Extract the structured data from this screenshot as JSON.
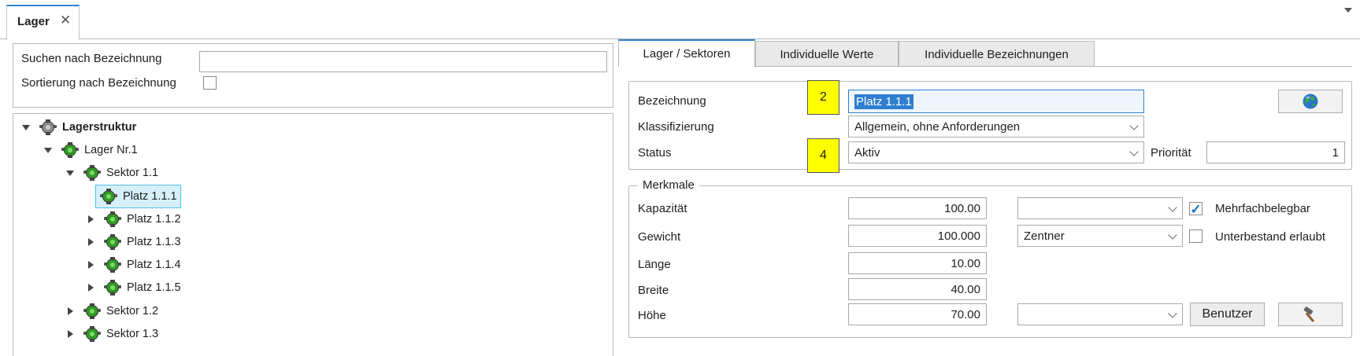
{
  "doc_tab": {
    "label": "Lager",
    "close": "✕"
  },
  "search": {
    "label": "Suchen nach Bezeichnung",
    "value": "",
    "sort_label": "Sortierung nach Bezeichnung",
    "sort_checked": false
  },
  "tree": {
    "nodes": [
      {
        "label": "Lagerstruktur",
        "level": 0,
        "expander": "expanded",
        "bold": true
      },
      {
        "label": "Lager Nr.1",
        "level": 1,
        "expander": "expanded"
      },
      {
        "label": "Sektor 1.1",
        "level": 2,
        "expander": "expanded"
      },
      {
        "label": "Platz 1.1.1",
        "level": 3,
        "expander": "none",
        "selected": true
      },
      {
        "label": "Platz 1.1.2",
        "level": 3,
        "expander": "collapsed"
      },
      {
        "label": "Platz 1.1.3",
        "level": 3,
        "expander": "collapsed"
      },
      {
        "label": "Platz 1.1.4",
        "level": 3,
        "expander": "collapsed"
      },
      {
        "label": "Platz 1.1.5",
        "level": 3,
        "expander": "collapsed"
      },
      {
        "label": "Sektor 1.2",
        "level": 2,
        "expander": "collapsed"
      },
      {
        "label": "Sektor 1.3",
        "level": 2,
        "expander": "collapsed"
      }
    ]
  },
  "tabs": [
    {
      "label": "Lager / Sektoren",
      "active": true
    },
    {
      "label": "Individuelle Werte",
      "active": false
    },
    {
      "label": "Individuelle Bezeichnungen",
      "active": false
    }
  ],
  "general": {
    "bezeichnung_label": "Bezeichnung",
    "bezeichnung_value": "Platz 1.1.1",
    "klassifizierung_label": "Klassifizierung",
    "klassifizierung_value": "Allgemein, ohne Anforderungen",
    "status_label": "Status",
    "status_value": "Aktiv",
    "prioritaet_label": "Priorität",
    "prioritaet_value": "1",
    "note_2": "2",
    "note_4": "4"
  },
  "merkmale": {
    "legend": "Merkmale",
    "rows": [
      {
        "label": "Kapazität",
        "value": "100.00",
        "unit": ""
      },
      {
        "label": "Gewicht",
        "value": "100.000",
        "unit": "Zentner"
      },
      {
        "label": "Länge",
        "value": "10.00"
      },
      {
        "label": "Breite",
        "value": "40.00"
      },
      {
        "label": "Höhe",
        "value": "70.00",
        "unit": ""
      }
    ],
    "mehrfach_label": "Mehrfachbelegbar",
    "mehrfach_checked": true,
    "unterbestand_label": "Unterbestand erlaubt",
    "unterbestand_checked": false,
    "benutzer_button": "Benutzer"
  },
  "icons": {
    "globe": "globe-icon",
    "hammer": "hammer-icon",
    "node": "storage-node-icon",
    "check": "✓"
  },
  "colors": {
    "accent": "#2f7fd1",
    "selection_bg": "#d6f0fb",
    "selection_border": "#4fc0e8",
    "note_yellow": "#ffff00",
    "node_green": "#2e8b1e"
  }
}
